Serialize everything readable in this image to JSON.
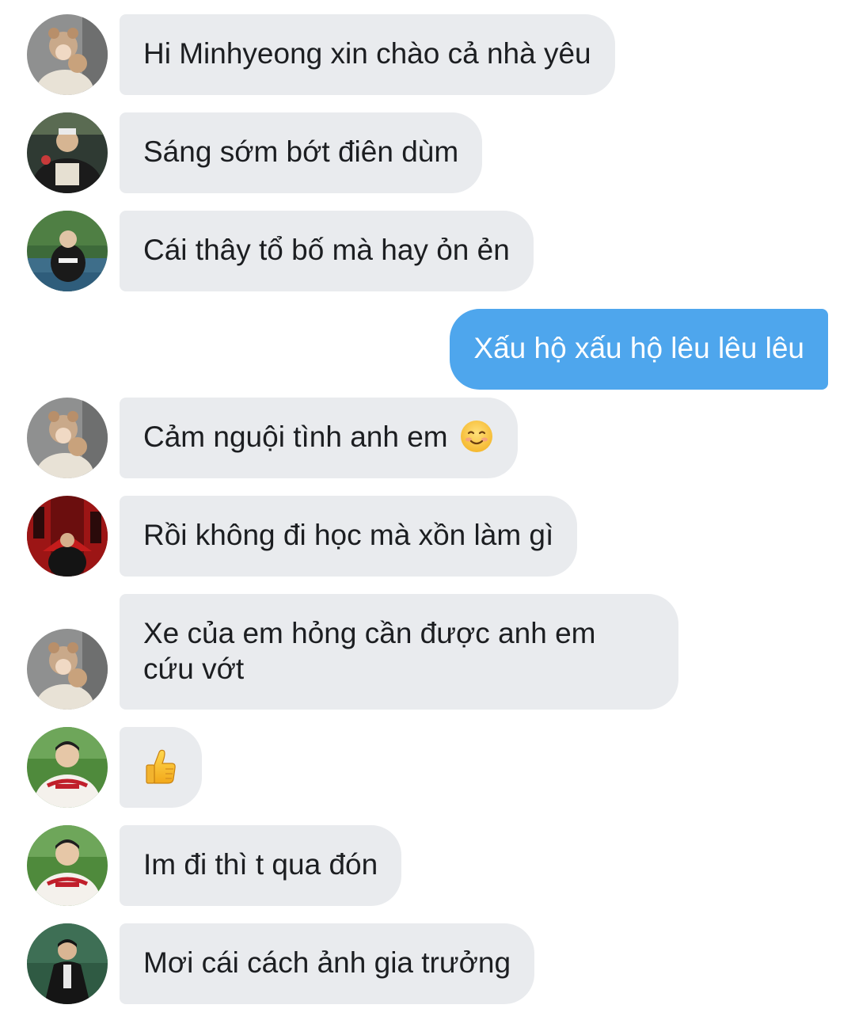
{
  "messages": [
    {
      "text": "Hi Minhyeong xin chào cả nhà yêu"
    },
    {
      "text": "Sáng sớm bớt điên dùm"
    },
    {
      "text": "Cái thây tổ bố mà hay ỏn ẻn"
    },
    {
      "text": "Xấu hộ xấu hộ lêu lêu lêu"
    },
    {
      "text": "Cảm nguội tình anh em",
      "emoji": "smiling-face-emoji"
    },
    {
      "text": "Rồi không đi học mà xồn làm gì"
    },
    {
      "line1": "Xe của em hỏng cần được anh em",
      "line2": "cứu vớt"
    },
    {
      "emoji": "thumbs-up-emoji"
    },
    {
      "text": "Im đi thì t qua đón"
    },
    {
      "text": "Mơi cái cách ảnh gia trưởng"
    }
  ],
  "colors": {
    "incoming_bubble": "#e9ebee",
    "outgoing_bubble": "#4ea6ed",
    "incoming_text": "#1c1e21",
    "outgoing_text": "#ffffff"
  }
}
